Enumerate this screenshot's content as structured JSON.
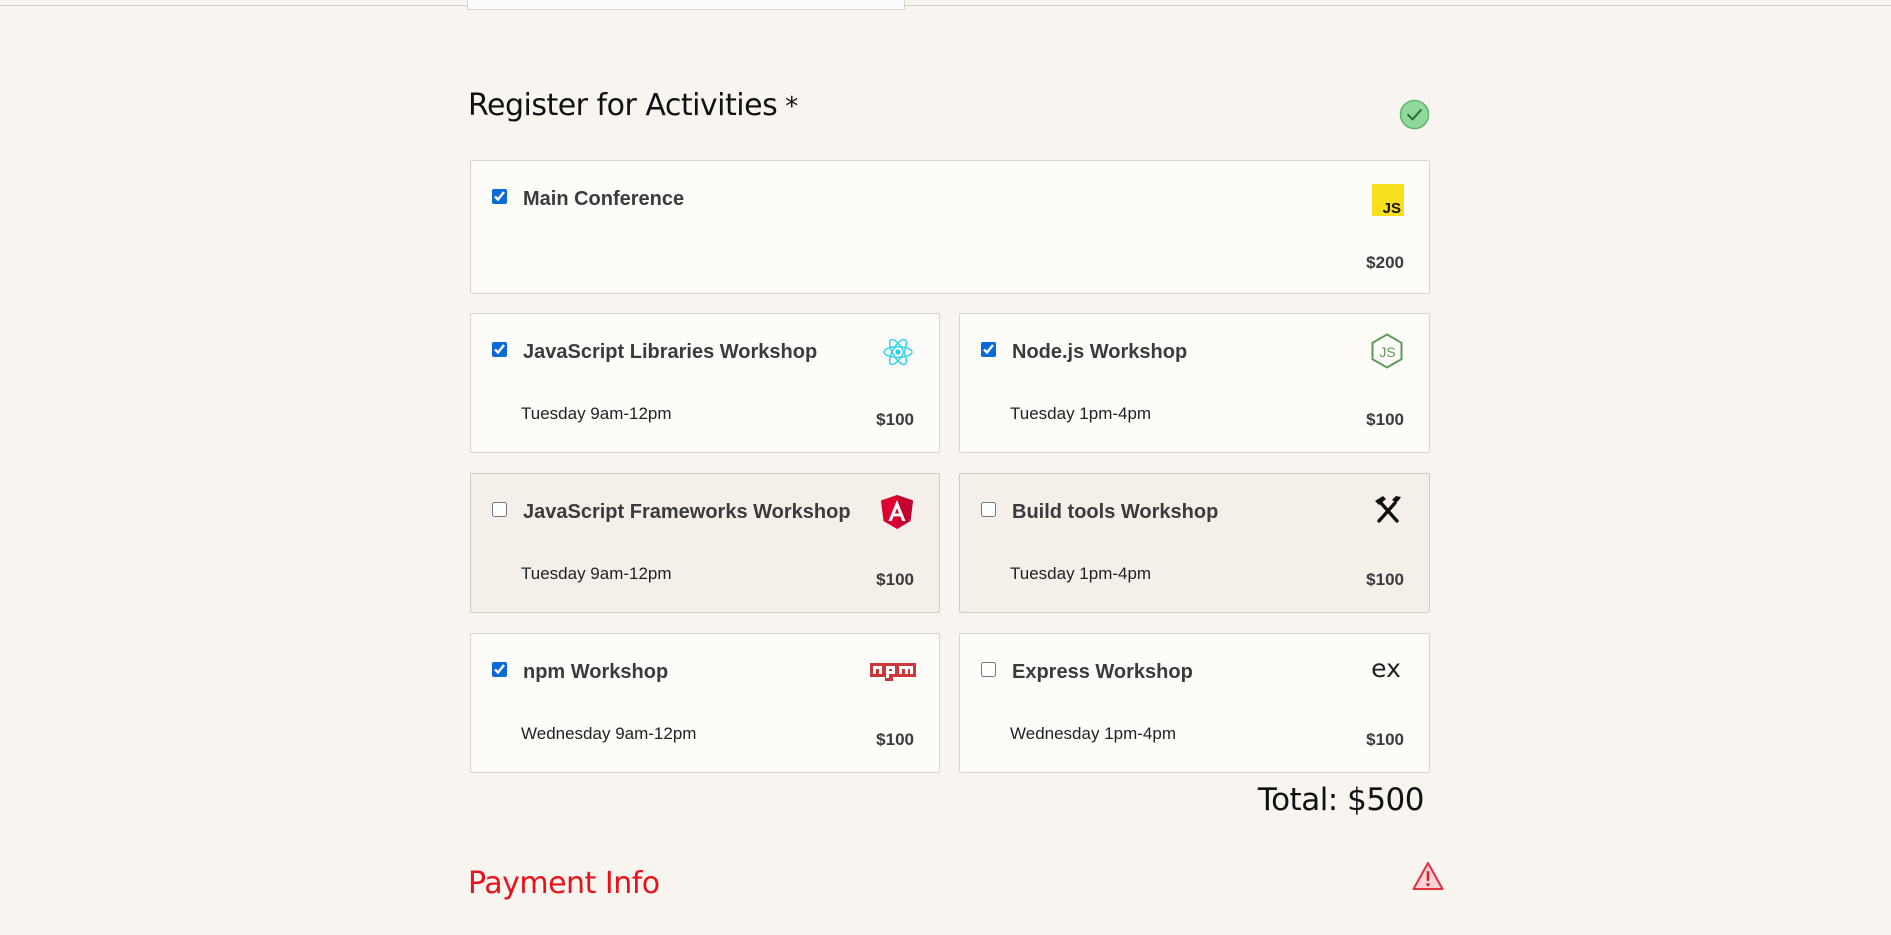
{
  "activities": {
    "title": "Register for Activities",
    "required_mark": "*",
    "status_icon": "valid-check-icon",
    "items": [
      {
        "name": "Main Conference",
        "time": "",
        "price": "$200",
        "checked": true,
        "icon": "javascript-logo-icon"
      },
      {
        "name": "JavaScript Libraries Workshop",
        "time": "Tuesday 9am-12pm",
        "price": "$100",
        "checked": true,
        "icon": "react-logo-icon"
      },
      {
        "name": "Node.js Workshop",
        "time": "Tuesday 1pm-4pm",
        "price": "$100",
        "checked": true,
        "icon": "nodejs-logo-icon"
      },
      {
        "name": "JavaScript Frameworks Workshop",
        "time": "Tuesday 9am-12pm",
        "price": "$100",
        "checked": false,
        "icon": "angular-logo-icon"
      },
      {
        "name": "Build tools Workshop",
        "time": "Tuesday 1pm-4pm",
        "price": "$100",
        "checked": false,
        "icon": "build-tools-icon"
      },
      {
        "name": "npm Workshop",
        "time": "Wednesday 9am-12pm",
        "price": "$100",
        "checked": true,
        "icon": "npm-logo-icon"
      },
      {
        "name": "Express Workshop",
        "time": "Wednesday 1pm-4pm",
        "price": "$100",
        "checked": false,
        "icon": "express-logo-icon"
      }
    ],
    "total": "Total: $500"
  },
  "payment": {
    "title": "Payment Info",
    "status_icon": "warning-icon"
  },
  "colors": {
    "page_background": "#f8f4ef",
    "checkbox_accent": "#0b6bd6",
    "error_red": "#e8121b",
    "valid_green": "#7ccf86"
  }
}
